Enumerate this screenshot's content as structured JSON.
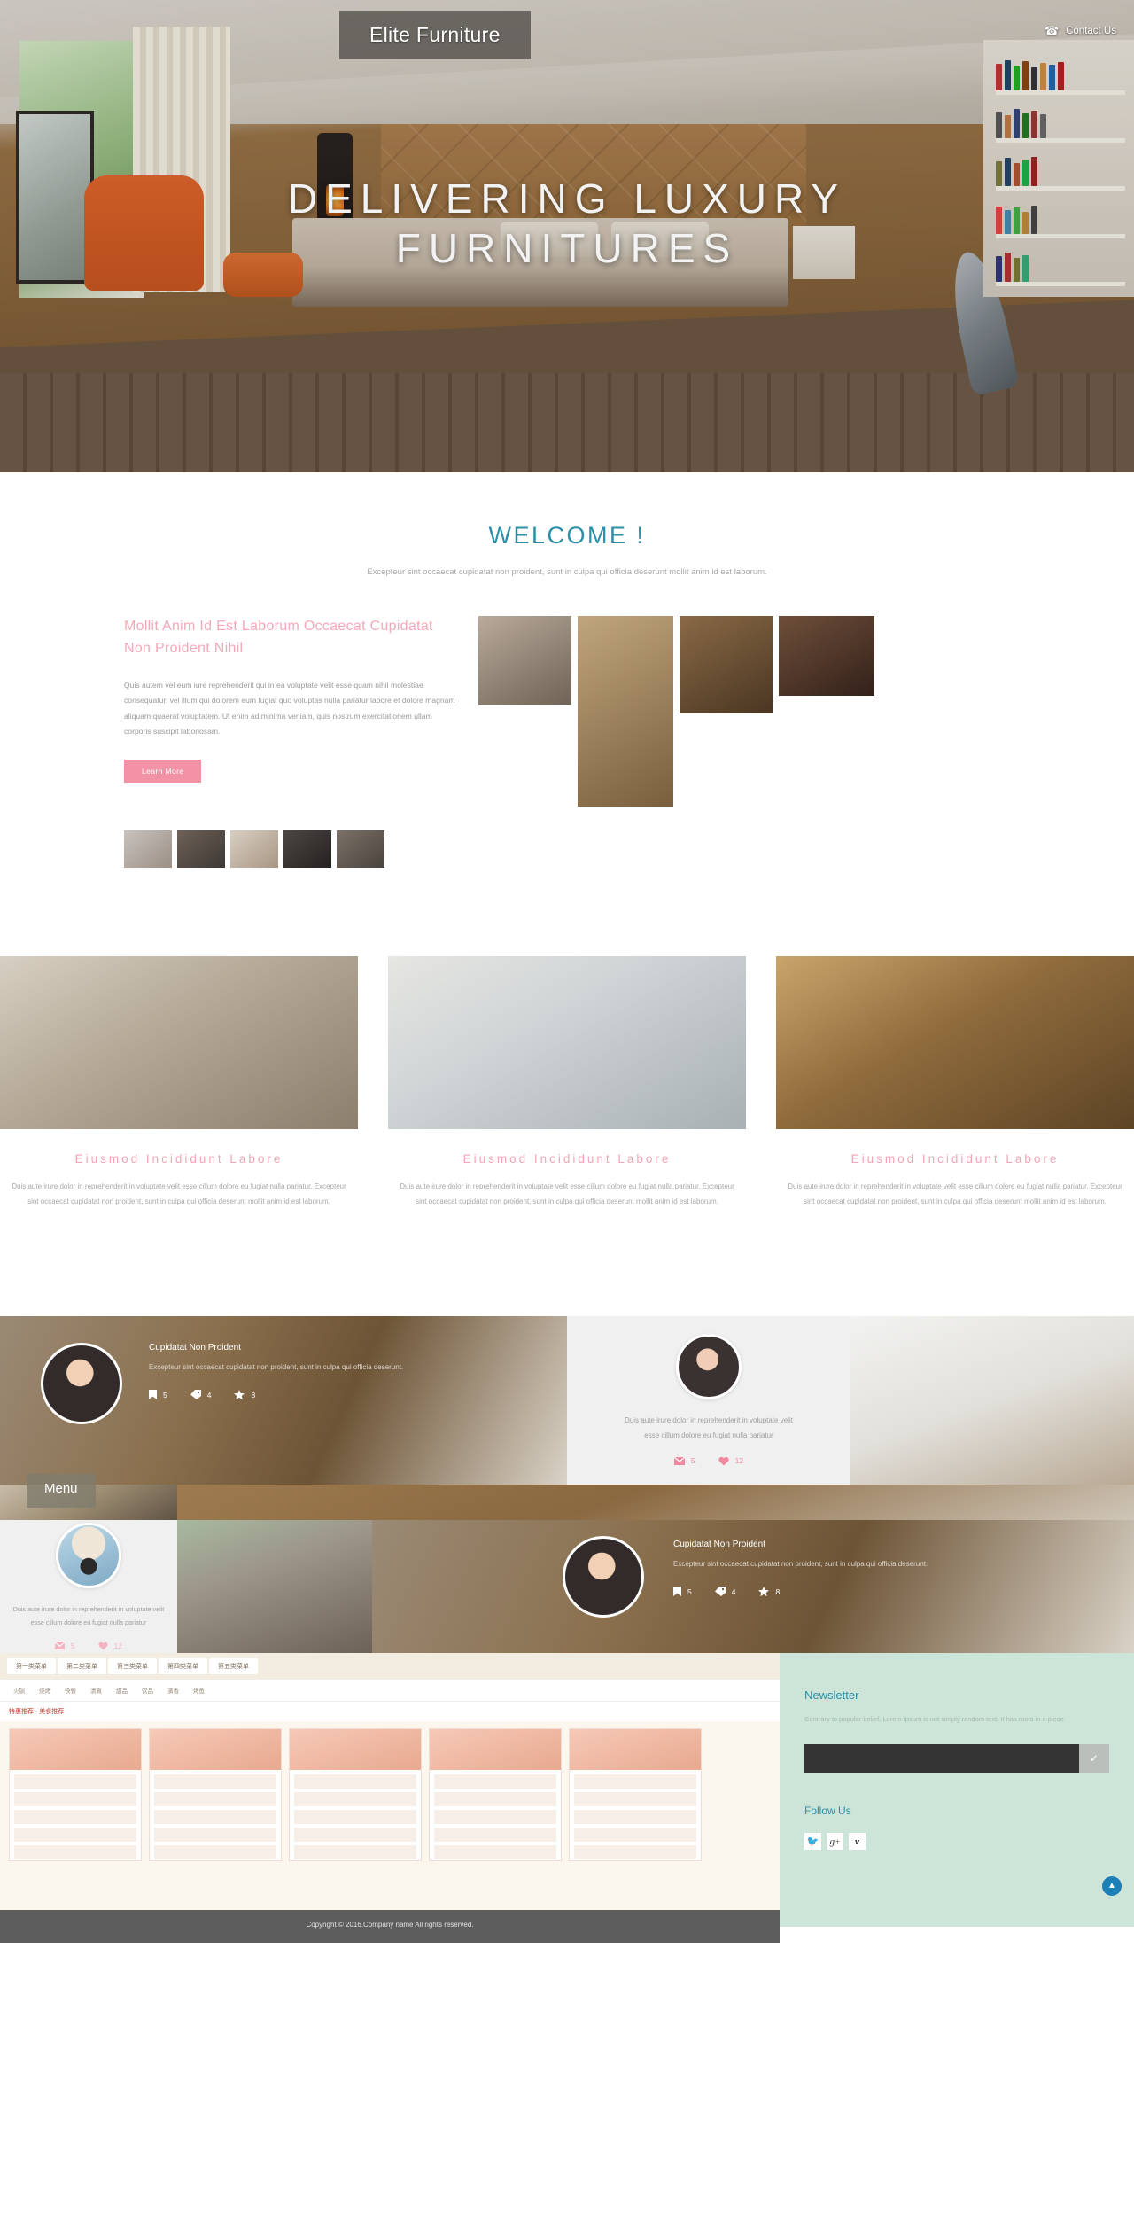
{
  "header": {
    "logo": "Elite Furniture",
    "contact_label": "Contact Us",
    "phone_icon": "phone-icon"
  },
  "hero": {
    "title_line1": "DELIVERING LUXURY",
    "title_line2": "FURNITURES"
  },
  "welcome": {
    "heading": "WELCOME !",
    "subtitle": "Excepteur sint occaecat cupidatat non proident, sunt in culpa qui officia deserunt mollit anim id est laborum.",
    "left_heading": "Mollit Anim Id Est Laborum Occaecat Cupidatat Non Proident Nihil",
    "left_paragraph": "Quis autem vel eum iure reprehenderit qui in ea voluptate velit esse quam nihil molestiae consequatur, vel illum qui dolorem eum fugiat quo voluptas nulla pariatur labore et dolore magnam aliquam quaerat voluptatem. Ut enim ad minima veniam, quis nostrum exercitationem ullam corporis suscipit laboriosam.",
    "learn_more": "Learn More"
  },
  "features": [
    {
      "title": "Eiusmod Incididunt Labore",
      "text": "Duis aute irure dolor in reprehenderit in voluptate velit esse cillum dolore eu fugiat nulla pariatur. Excepteur sint occaecat cupidatat non proident, sunt in culpa qui officia deserunt mollit anim id est laborum."
    },
    {
      "title": "Eiusmod Incididunt Labore",
      "text": "Duis aute irure dolor in reprehenderit in voluptate velit esse cillum dolore eu fugiat nulla pariatur. Excepteur sint occaecat cupidatat non proident, sunt in culpa qui officia deserunt mollit anim id est laborum."
    },
    {
      "title": "Eiusmod Incididunt Labore",
      "text": "Duis aute irure dolor in reprehenderit in voluptate velit esse cillum dolore eu fugiat nulla pariatur. Excepteur sint occaecat cupidatat non proident, sunt in culpa qui officia deserunt mollit anim id est laborum."
    }
  ],
  "posts": {
    "dark_card_top": {
      "title": "Cupidatat Non Proident",
      "text": "Excepteur sint occaecat cupidatat non proident, sunt in culpa qui officia deserunt.",
      "stats": [
        {
          "icon": "bookmark-icon",
          "value": "5"
        },
        {
          "icon": "tag-icon",
          "value": "4"
        },
        {
          "icon": "star-icon",
          "value": "8"
        }
      ]
    },
    "dark_card_bottom": {
      "title": "Cupidatat Non Proident",
      "text": "Excepteur sint occaecat cupidatat non proident, sunt in culpa qui officia deserunt.",
      "stats": [
        {
          "icon": "bookmark-icon",
          "value": "5"
        },
        {
          "icon": "tag-icon",
          "value": "4"
        },
        {
          "icon": "star-icon",
          "value": "8"
        }
      ]
    },
    "white_card_top": {
      "text": "Duis aute irure dolor in reprehenderit in voluptate velit esse cillum dolore eu fugiat nulla pariatur",
      "stats": [
        {
          "icon": "envelope-icon",
          "value": "5"
        },
        {
          "icon": "heart-icon",
          "value": "12"
        }
      ]
    },
    "white_card_bottom": {
      "text": "Duis aute irure dolor in reprehenderit in voluptate velit esse cillum dolore eu fugiat nulla pariatur",
      "stats": [
        {
          "icon": "envelope-icon",
          "value": "5"
        },
        {
          "icon": "heart-icon",
          "value": "12"
        }
      ]
    },
    "menu_button": "Menu"
  },
  "newsletter": {
    "heading": "Newsletter",
    "text": "Contrary to popular belief, Lorem Ipsum is not simply random text. It has roots in a piece.",
    "input_value": "",
    "input_placeholder": "",
    "submit_icon": "check-icon",
    "follow_heading": "Follow Us",
    "socials": [
      {
        "name": "twitter-icon",
        "glyph": "🐦"
      },
      {
        "name": "google-plus-icon",
        "glyph": "g⁺"
      },
      {
        "name": "vimeo-icon",
        "glyph": "𝐗"
      }
    ],
    "scroll_top_icon": "chevron-up-icon"
  },
  "footer": {
    "copyright": "Copyright © 2016.Company name All rights reserved."
  },
  "colors": {
    "accent_pink": "#f2a5b5",
    "accent_teal": "#2b8fa8",
    "newsletter_bg": "#cde5d8",
    "footer_bg": "#5d5d5d"
  }
}
